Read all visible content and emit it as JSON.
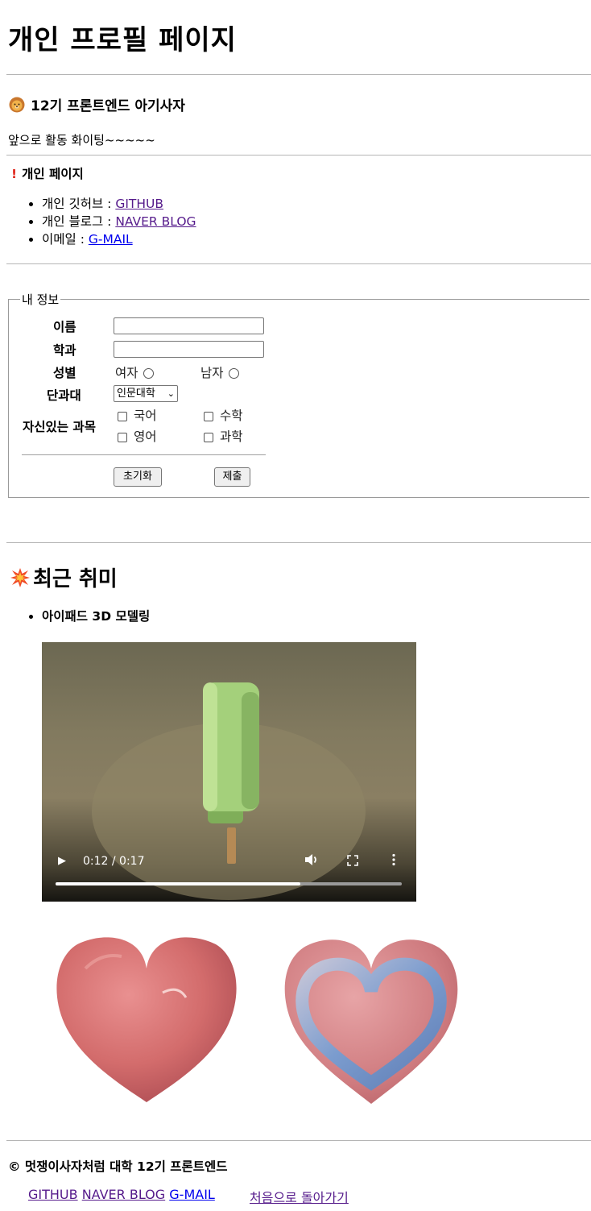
{
  "page": {
    "title": "개인 프로필 페이지"
  },
  "intro": {
    "heading": "12기 프론트엔드 아기사자",
    "icon": "lion-face-icon",
    "text": "앞으로 활동 화이팅~~~~~"
  },
  "personal": {
    "heading": "개인 페이지",
    "icon": "exclamation-icon",
    "links": [
      {
        "label": "개인 깃허브 : ",
        "link_text": "GITHUB"
      },
      {
        "label": "개인 블로그 : ",
        "link_text": "NAVER BLOG"
      },
      {
        "label": "이메일 : ",
        "link_text": "G-MAIL"
      }
    ]
  },
  "form": {
    "legend": "내 정보",
    "name_label": "이름",
    "name_value": "",
    "major_label": "학과",
    "major_value": "",
    "gender_label": "성별",
    "gender_female": "여자",
    "gender_male": "남자",
    "college_label": "단과대",
    "college_selected": "인문대학",
    "subjects_label": "자신있는 과목",
    "subjects": [
      "국어",
      "수학",
      "영어",
      "과학"
    ],
    "reset_label": "초기화",
    "submit_label": "제출"
  },
  "hobby": {
    "heading": "최근 취미",
    "icon": "collision-icon",
    "item": "아이패드 3D 모델링",
    "video": {
      "time": "0:12 / 0:17",
      "progress_fraction": 0.706
    }
  },
  "footer": {
    "copyright": "© 멋쟁이사자처럼 대학 12기 프론트엔드",
    "links": [
      "GITHUB",
      "NAVER BLOG",
      "G-MAIL"
    ],
    "back_to_top": "처음으로 돌아가기"
  },
  "colors": {
    "link_visited": "#551a8b",
    "link_unvisited": "#0000ee",
    "heart_pink": "#d76f70",
    "heart_blue": "#7d9ccf"
  }
}
